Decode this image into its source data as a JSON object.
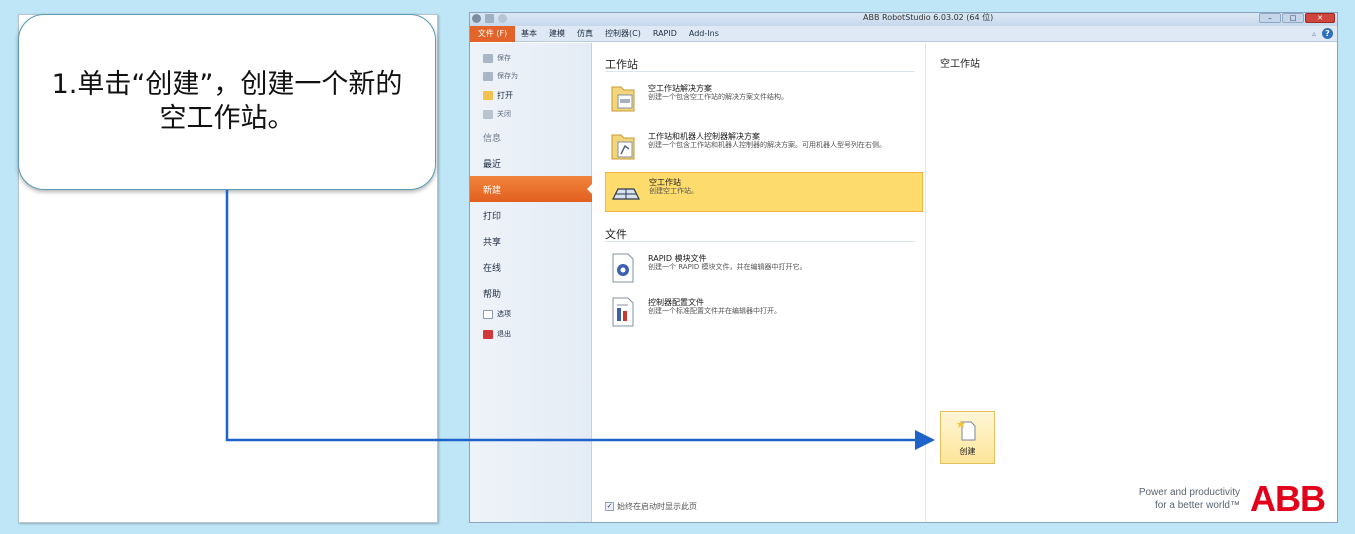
{
  "callout": {
    "text": "1.单击“创建”，创建一个新的空工作站。"
  },
  "window": {
    "title": "ABB RobotStudio 6.03.02 (64 位)",
    "controls": [
      "–",
      "□",
      "✕"
    ]
  },
  "ribbon": {
    "tabs": [
      "文件 (F)",
      "基本",
      "建模",
      "仿真",
      "控制器(C)",
      "RAPID",
      "Add-Ins"
    ]
  },
  "backstage_menu": {
    "save": "保存",
    "save_as": "保存为",
    "open": "打开",
    "close": "关闭",
    "info": "信息",
    "recent": "最近",
    "new": "新建",
    "print": "打印",
    "share": "共享",
    "online": "在线",
    "help": "帮助",
    "options": "选项",
    "exit": "退出"
  },
  "workstation_section": {
    "title": "工作站",
    "items": [
      {
        "title": "空工作站解决方案",
        "desc": "创建一个包含空工作站的解决方案文件结构。"
      },
      {
        "title": "工作站和机器人控制器解决方案",
        "desc": "创建一个包含工作站和机器人控制器的解决方案。可用机器人型号列在右侧。"
      },
      {
        "title": "空工作站",
        "desc": "创建空工作站。"
      }
    ]
  },
  "file_section": {
    "title": "文件",
    "items": [
      {
        "title": "RAPID 模块文件",
        "desc": "创建一个 RAPID 模块文件，并在编辑器中打开它。"
      },
      {
        "title": "控制器配置文件",
        "desc": "创建一个标准配置文件并在编辑器中打开。"
      }
    ]
  },
  "startup_checkbox": {
    "label": "始终在启动时显示此页",
    "checked": true
  },
  "right_pane": {
    "title": "空工作站",
    "create_label": "创建"
  },
  "brand": {
    "tagline_1": "Power and productivity",
    "tagline_2": "for a better world™",
    "logo": "ABB"
  },
  "colors": {
    "accent": "#e3642a",
    "selected_item": "#fddb6c",
    "arrow": "#1d63c9",
    "logo": "#e2001a"
  }
}
